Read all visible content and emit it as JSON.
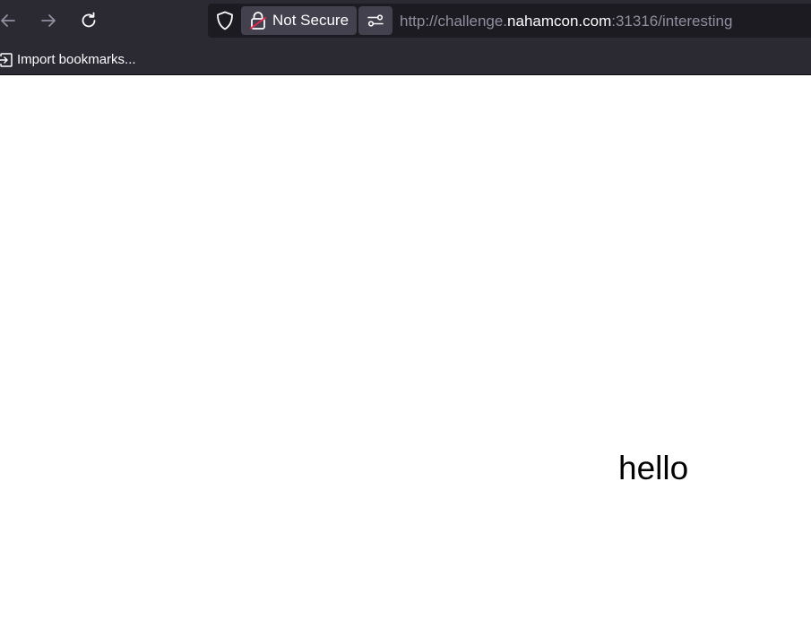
{
  "toolbar": {
    "back_icon": "arrow-left-icon",
    "forward_icon": "arrow-right-icon",
    "reload_icon": "reload-icon"
  },
  "urlbar": {
    "shield_icon": "shield-icon",
    "security_label": "Not Secure",
    "security_icon": "broken-lock-icon",
    "permissions_icon": "sliders-icon",
    "url_prefix": "http://challenge.",
    "url_domain": "nahamcon.com",
    "url_suffix": ":31316/interesting"
  },
  "bookmarks_bar": {
    "import_label": "Import bookmarks...",
    "import_icon": "import-icon"
  },
  "page": {
    "body_text": "hello"
  },
  "colors": {
    "chrome_bg": "#2b2a33",
    "urlbar_bg": "#1c1b22",
    "pill_bg": "#42414d",
    "insecure_accent": "#e22850",
    "text_light": "#fbfbfe",
    "text_dim": "#8f8f9d"
  }
}
